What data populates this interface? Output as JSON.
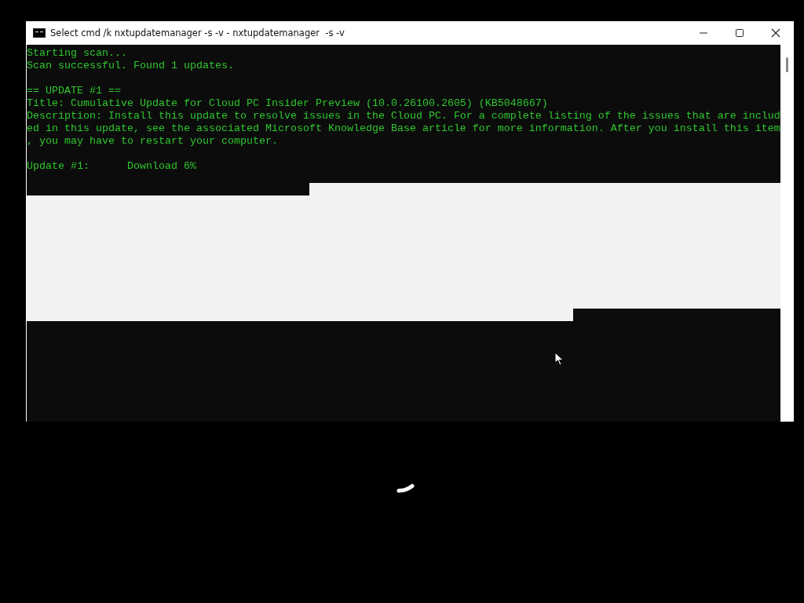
{
  "window": {
    "title": "Select cmd /k nxtupdatemanager -s -v - nxtupdatemanager  -s -v"
  },
  "console": {
    "blocks": [
      [
        "Starting scan...",
        "Scan successful. Found 1 updates."
      ],
      [
        "== UPDATE #1 ==",
        "Title: Cumulative Update for Cloud PC Insider Preview (10.0.26100.2605) (KB5048667)",
        "Description: Install this update to resolve issues in the Cloud PC. For a complete listing of the issues that are includ",
        "ed in this update, see the associated Microsoft Knowledge Base article for more information. After you install this item",
        ", you may have to restart your computer."
      ],
      [
        "Update #1:      Download 6%"
      ]
    ]
  }
}
